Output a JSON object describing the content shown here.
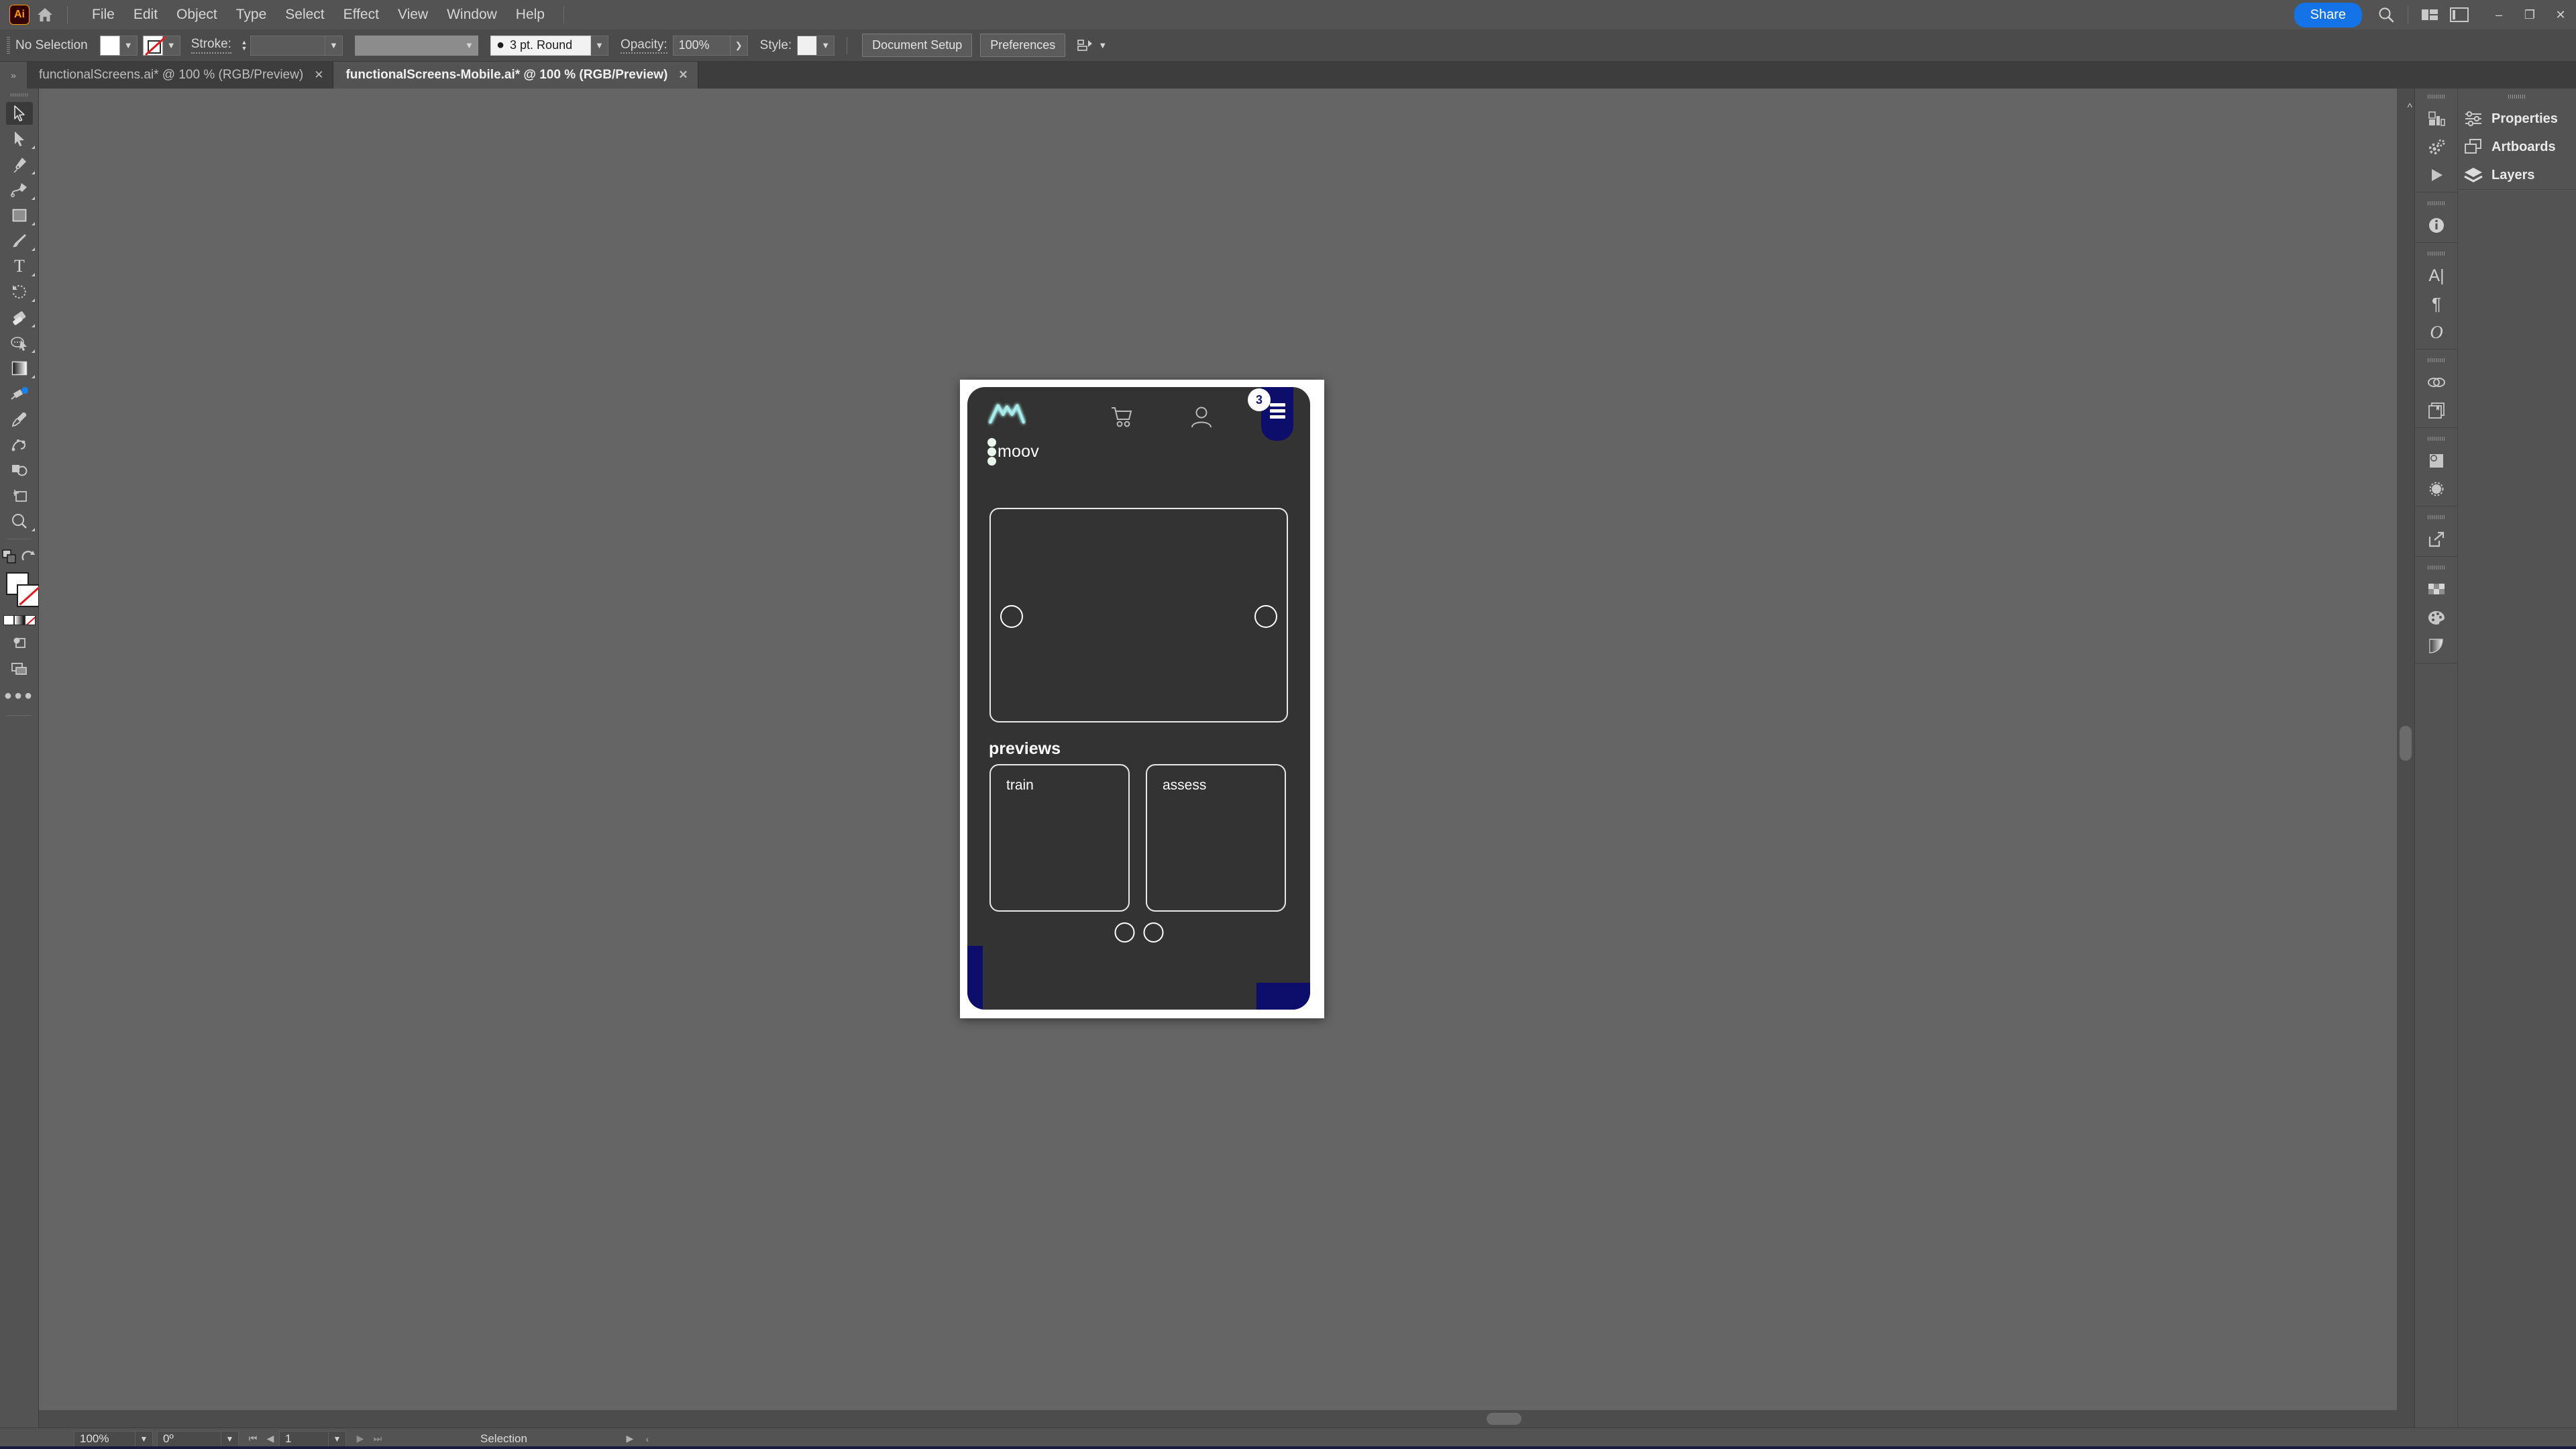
{
  "app": {
    "logo_text": "Ai",
    "home_icon": "home-icon"
  },
  "menubar": {
    "items": [
      "File",
      "Edit",
      "Object",
      "Type",
      "Select",
      "Effect",
      "View",
      "Window",
      "Help"
    ],
    "share_label": "Share",
    "search_icon": "search-icon",
    "arrange_icon": "arrange-documents-icon",
    "workspace_icon": "workspace-switcher-icon",
    "minimize": "–",
    "maximize": "❐",
    "close": "✕"
  },
  "controlbar": {
    "selection_status": "No Selection",
    "fill_swatch": "#ffffff",
    "stroke_swatch": "none",
    "stroke_label": "Stroke:",
    "stroke_weight": "",
    "variable_width": "",
    "brush_definition": "3 pt. Round",
    "opacity_label": "Opacity:",
    "opacity_value": "100%",
    "style_label": "Style:",
    "style_swatch": "#f0f0f0",
    "document_setup_label": "Document Setup",
    "preferences_label": "Preferences",
    "align_icon": "align-objects-icon"
  },
  "tabs": {
    "chevrons": "»",
    "items": [
      {
        "title": "functionalScreens.ai* @ 100 % (RGB/Preview)",
        "active": false,
        "close": "✕"
      },
      {
        "title": "functionalScreens-Mobile.ai* @ 100 % (RGB/Preview)",
        "active": true,
        "close": "✕"
      }
    ]
  },
  "toolbar": {
    "tools": [
      {
        "name": "selection-tool",
        "selected": true,
        "flyout": false
      },
      {
        "name": "direct-selection-tool",
        "selected": false,
        "flyout": true
      },
      {
        "name": "pen-tool",
        "selected": false,
        "flyout": true
      },
      {
        "name": "curvature-tool",
        "selected": false,
        "flyout": true
      },
      {
        "name": "rectangle-tool",
        "selected": false,
        "flyout": true
      },
      {
        "name": "paintbrush-tool",
        "selected": false,
        "flyout": true
      },
      {
        "name": "type-tool",
        "selected": false,
        "flyout": true
      },
      {
        "name": "rotate-tool",
        "selected": false,
        "flyout": true
      },
      {
        "name": "eraser-tool",
        "selected": false,
        "flyout": true
      },
      {
        "name": "shape-builder-tool",
        "selected": false,
        "flyout": true
      },
      {
        "name": "gradient-tool",
        "selected": false,
        "flyout": true
      },
      {
        "name": "free-transform-tool",
        "selected": false,
        "flyout": false
      },
      {
        "name": "eyedropper-tool",
        "selected": false,
        "flyout": false
      },
      {
        "name": "puppet-warp-tool",
        "selected": false,
        "flyout": false
      },
      {
        "name": "shaper-tool",
        "selected": false,
        "flyout": false
      },
      {
        "name": "artboard-tool",
        "selected": false,
        "flyout": false
      },
      {
        "name": "zoom-tool",
        "selected": false,
        "flyout": true
      }
    ],
    "fill_color": "#ffffff",
    "stroke_color": "none",
    "swap_icon": "swap-fill-stroke-icon",
    "default_icon": "default-fill-stroke-icon",
    "color_mode_icons": [
      "color-swatch-icon",
      "gradient-swatch-icon",
      "none-swatch-icon"
    ],
    "draw_mode_icon": "drawing-modes-icon",
    "screen_mode_icon": "screen-mode-icon",
    "edit_toolbar_icon": "edit-toolbar-ellipsis-icon"
  },
  "artboard": {
    "header": {
      "logo_name": "moov-mountain-logo",
      "cart_icon": "shopping-cart-icon",
      "account_icon": "user-account-icon",
      "menu_icon": "hamburger-menu-icon",
      "badge_count": "3",
      "brand_name": "moov",
      "braille_icon": "braille-dots-icon"
    },
    "hero": {
      "name": "hero-card",
      "left_ring": "carousel-prev-ring",
      "right_ring": "carousel-next-ring"
    },
    "previews": {
      "title": "previews",
      "cards": [
        {
          "label": "train"
        },
        {
          "label": "assess"
        }
      ],
      "dots": 2
    },
    "colors": {
      "phone_bg": "#333333",
      "accent_navy": "#0d0d6b",
      "logo_glow": "#9fe8e8",
      "stroke_white": "#e8e8e8"
    }
  },
  "rightdock": {
    "icons_group_a": [
      "graph-tool-icon",
      "gear-settings-icon",
      "play-action-icon"
    ],
    "icons_group_b": [
      "info-icon"
    ],
    "icons_group_c": [
      "character-icon",
      "paragraph-icon",
      "opentype-icon"
    ],
    "icons_group_d": [
      "links-icon",
      "libraries-icon"
    ],
    "icons_group_e": [
      "appearance-icon",
      "transparency-icon"
    ],
    "icons_group_f": [
      "export-icon"
    ],
    "icons_group_g": [
      "swatches-icon",
      "color-palette-icon",
      "color-guide-icon"
    ],
    "panels": [
      {
        "label": "Properties",
        "icon": "sliders-icon"
      },
      {
        "label": "Artboards",
        "icon": "artboards-icon"
      },
      {
        "label": "Layers",
        "icon": "layers-icon"
      }
    ]
  },
  "statusbar": {
    "zoom_level": "100%",
    "rotation": "0º",
    "artboard_number": "1",
    "status_text": "Selection",
    "first_icon": "first-artboard-icon",
    "prev_icon": "prev-artboard-icon",
    "next_icon": "next-artboard-icon",
    "last_icon": "last-artboard-icon",
    "menu_arrow": "▶",
    "resize_arrow": "‹"
  }
}
